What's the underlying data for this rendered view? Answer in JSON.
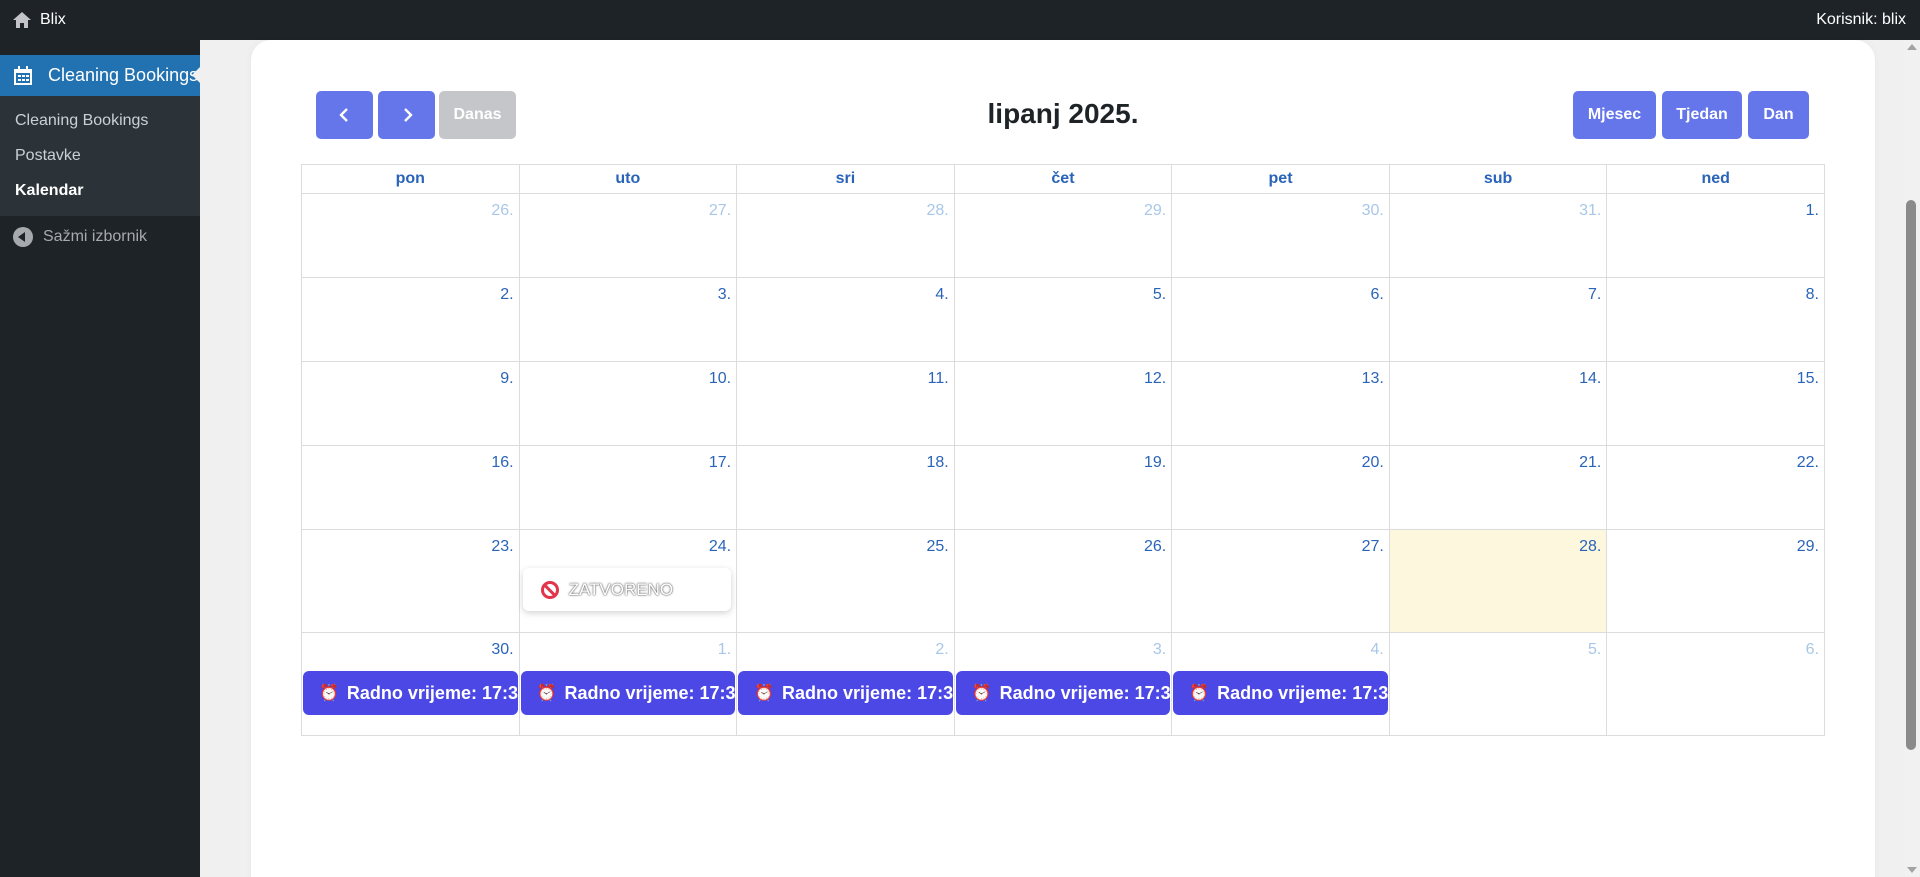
{
  "adminbar": {
    "site_name": "Blix",
    "user_label": "Korisnik: blix"
  },
  "sidebar": {
    "top_item": "Cleaning Bookings",
    "submenu": [
      {
        "label": "Cleaning Bookings",
        "current": false
      },
      {
        "label": "Postavke",
        "current": false
      },
      {
        "label": "Kalendar",
        "current": true
      }
    ],
    "collapse_label": "Sažmi izbornik"
  },
  "calendar": {
    "title": "lipanj 2025.",
    "buttons": {
      "today": "Danas",
      "month": "Mjesec",
      "week": "Tjedan",
      "day": "Dan"
    },
    "weekdays": [
      "pon",
      "uto",
      "sri",
      "čet",
      "pet",
      "sub",
      "ned"
    ],
    "weeks": [
      [
        {
          "d": "26.",
          "other": true
        },
        {
          "d": "27.",
          "other": true
        },
        {
          "d": "28.",
          "other": true
        },
        {
          "d": "29.",
          "other": true
        },
        {
          "d": "30.",
          "other": true
        },
        {
          "d": "31.",
          "other": true
        },
        {
          "d": "1.",
          "other": false
        }
      ],
      [
        {
          "d": "2."
        },
        {
          "d": "3."
        },
        {
          "d": "4."
        },
        {
          "d": "5."
        },
        {
          "d": "6."
        },
        {
          "d": "7."
        },
        {
          "d": "8."
        }
      ],
      [
        {
          "d": "9."
        },
        {
          "d": "10."
        },
        {
          "d": "11."
        },
        {
          "d": "12."
        },
        {
          "d": "13."
        },
        {
          "d": "14."
        },
        {
          "d": "15."
        }
      ],
      [
        {
          "d": "16."
        },
        {
          "d": "17."
        },
        {
          "d": "18."
        },
        {
          "d": "19."
        },
        {
          "d": "20."
        },
        {
          "d": "21."
        },
        {
          "d": "22."
        }
      ],
      [
        {
          "d": "23."
        },
        {
          "d": "24.",
          "closed": "ZATVORENO"
        },
        {
          "d": "25."
        },
        {
          "d": "26."
        },
        {
          "d": "27."
        },
        {
          "d": "28.",
          "today": true
        },
        {
          "d": "29."
        }
      ],
      [
        {
          "d": "30.",
          "event": "Radno vrijeme: 17:3"
        },
        {
          "d": "1.",
          "other": true,
          "event": "Radno vrijeme: 17:3"
        },
        {
          "d": "2.",
          "other": true,
          "event": "Radno vrijeme: 17:3"
        },
        {
          "d": "3.",
          "other": true,
          "event": "Radno vrijeme: 17:3"
        },
        {
          "d": "4.",
          "other": true,
          "event": "Radno vrijeme: 17:3"
        },
        {
          "d": "5.",
          "other": true
        },
        {
          "d": "6.",
          "other": true
        }
      ]
    ],
    "event_icon": "alarm-clock-icon",
    "closed_icon": "prohibited-icon"
  },
  "colors": {
    "accent": "#6476e9",
    "event": "#4c48e6",
    "today": "#fdf7dd",
    "admin_blue": "#2271b1"
  }
}
